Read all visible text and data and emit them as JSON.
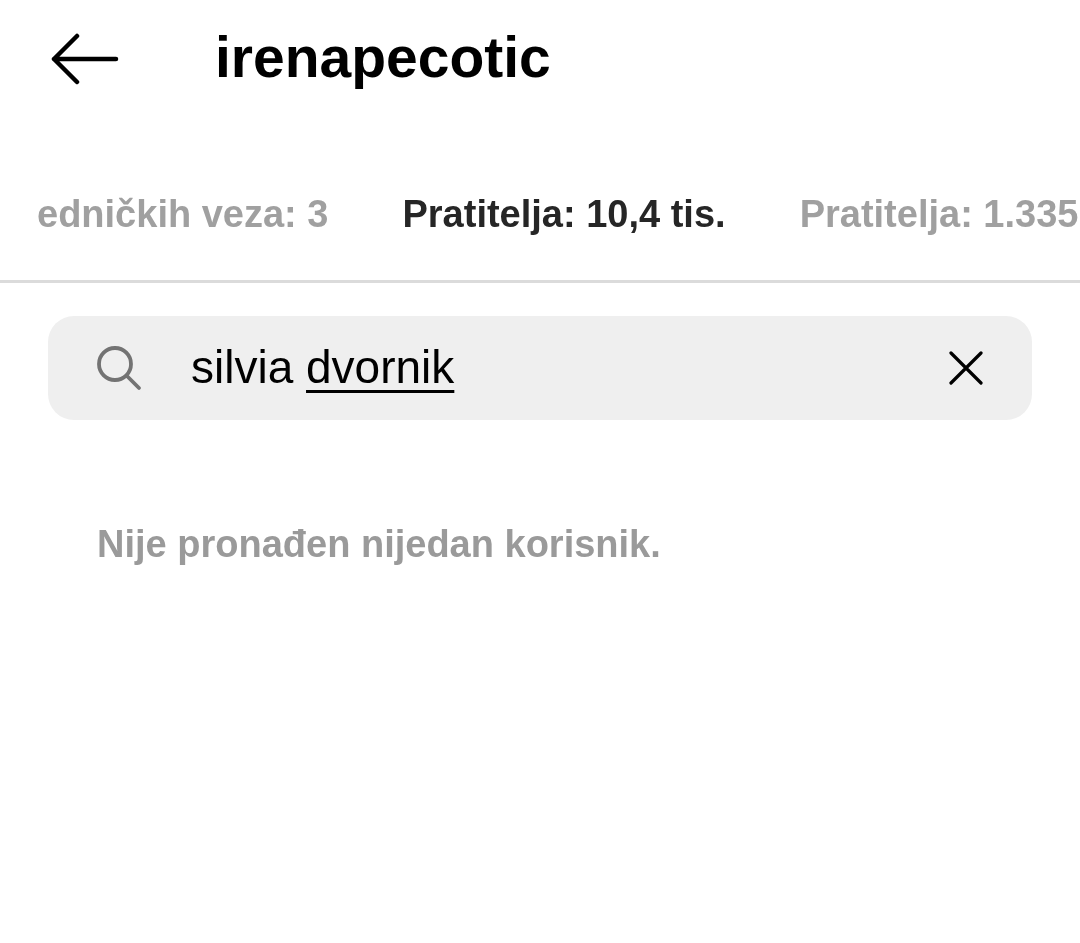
{
  "header": {
    "title": "irenapecotic"
  },
  "tabs": [
    {
      "label": "edničkih veza: 3",
      "selected": false
    },
    {
      "label": "Pratitelja: 10,4 tis.",
      "selected": true
    },
    {
      "label": "Pratitelja: 1.335",
      "selected": false
    }
  ],
  "search": {
    "value": "silvia",
    "composing_text": "dvornik"
  },
  "empty_message": "Nije pronađen nijedan korisnik."
}
